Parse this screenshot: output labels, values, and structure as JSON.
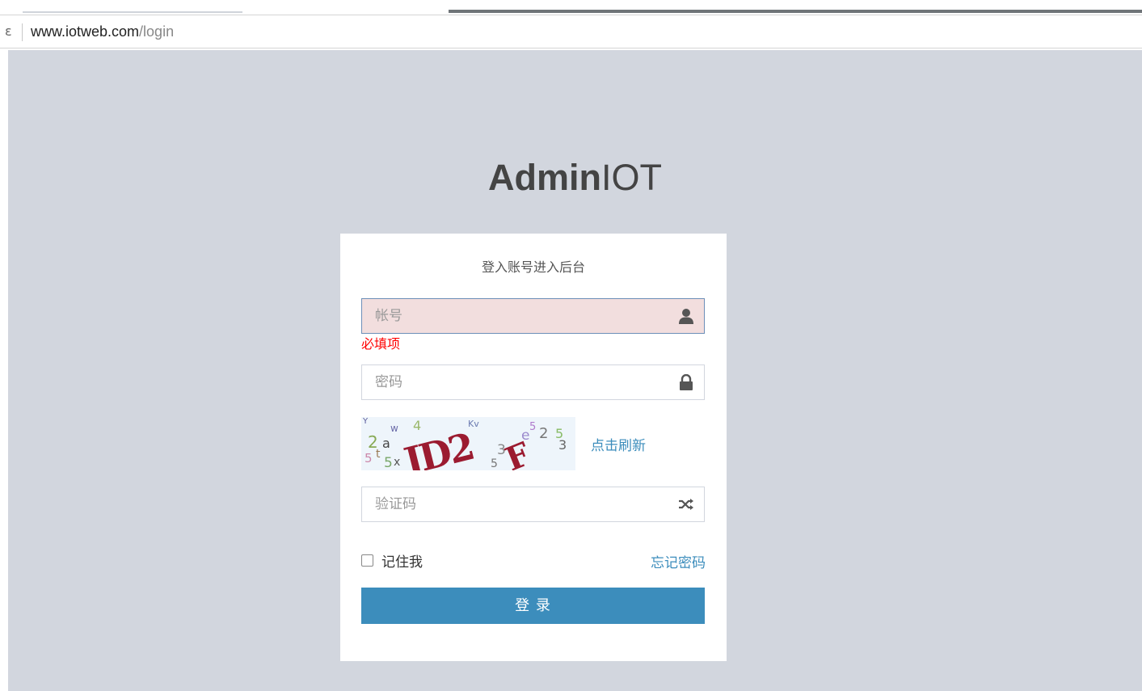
{
  "browser": {
    "address_left_glyph": "ε",
    "url_host": "www.iotweb.com",
    "url_path": "/login"
  },
  "logo": {
    "bold": "Admin",
    "light": "IOT"
  },
  "login_box": {
    "message": "登入账号进入后台",
    "username": {
      "placeholder": "帐号",
      "value": "",
      "icon": "user-icon"
    },
    "username_error": "必填项",
    "password": {
      "placeholder": "密码",
      "value": "",
      "icon": "lock-icon"
    },
    "captcha_text": "JD2F",
    "refresh_label": "点击刷新",
    "verify_code": {
      "placeholder": "验证码",
      "value": "",
      "icon": "random-icon"
    },
    "remember_label": "记住我",
    "remember_checked": false,
    "forgot_label": "忘记密码",
    "submit_label": "登 录"
  },
  "colors": {
    "page_bg": "#d2d6de",
    "primary": "#3c8dbc",
    "error": "#ff0000",
    "error_field_bg": "#f2dede",
    "captcha_main": "#9b1b30"
  }
}
